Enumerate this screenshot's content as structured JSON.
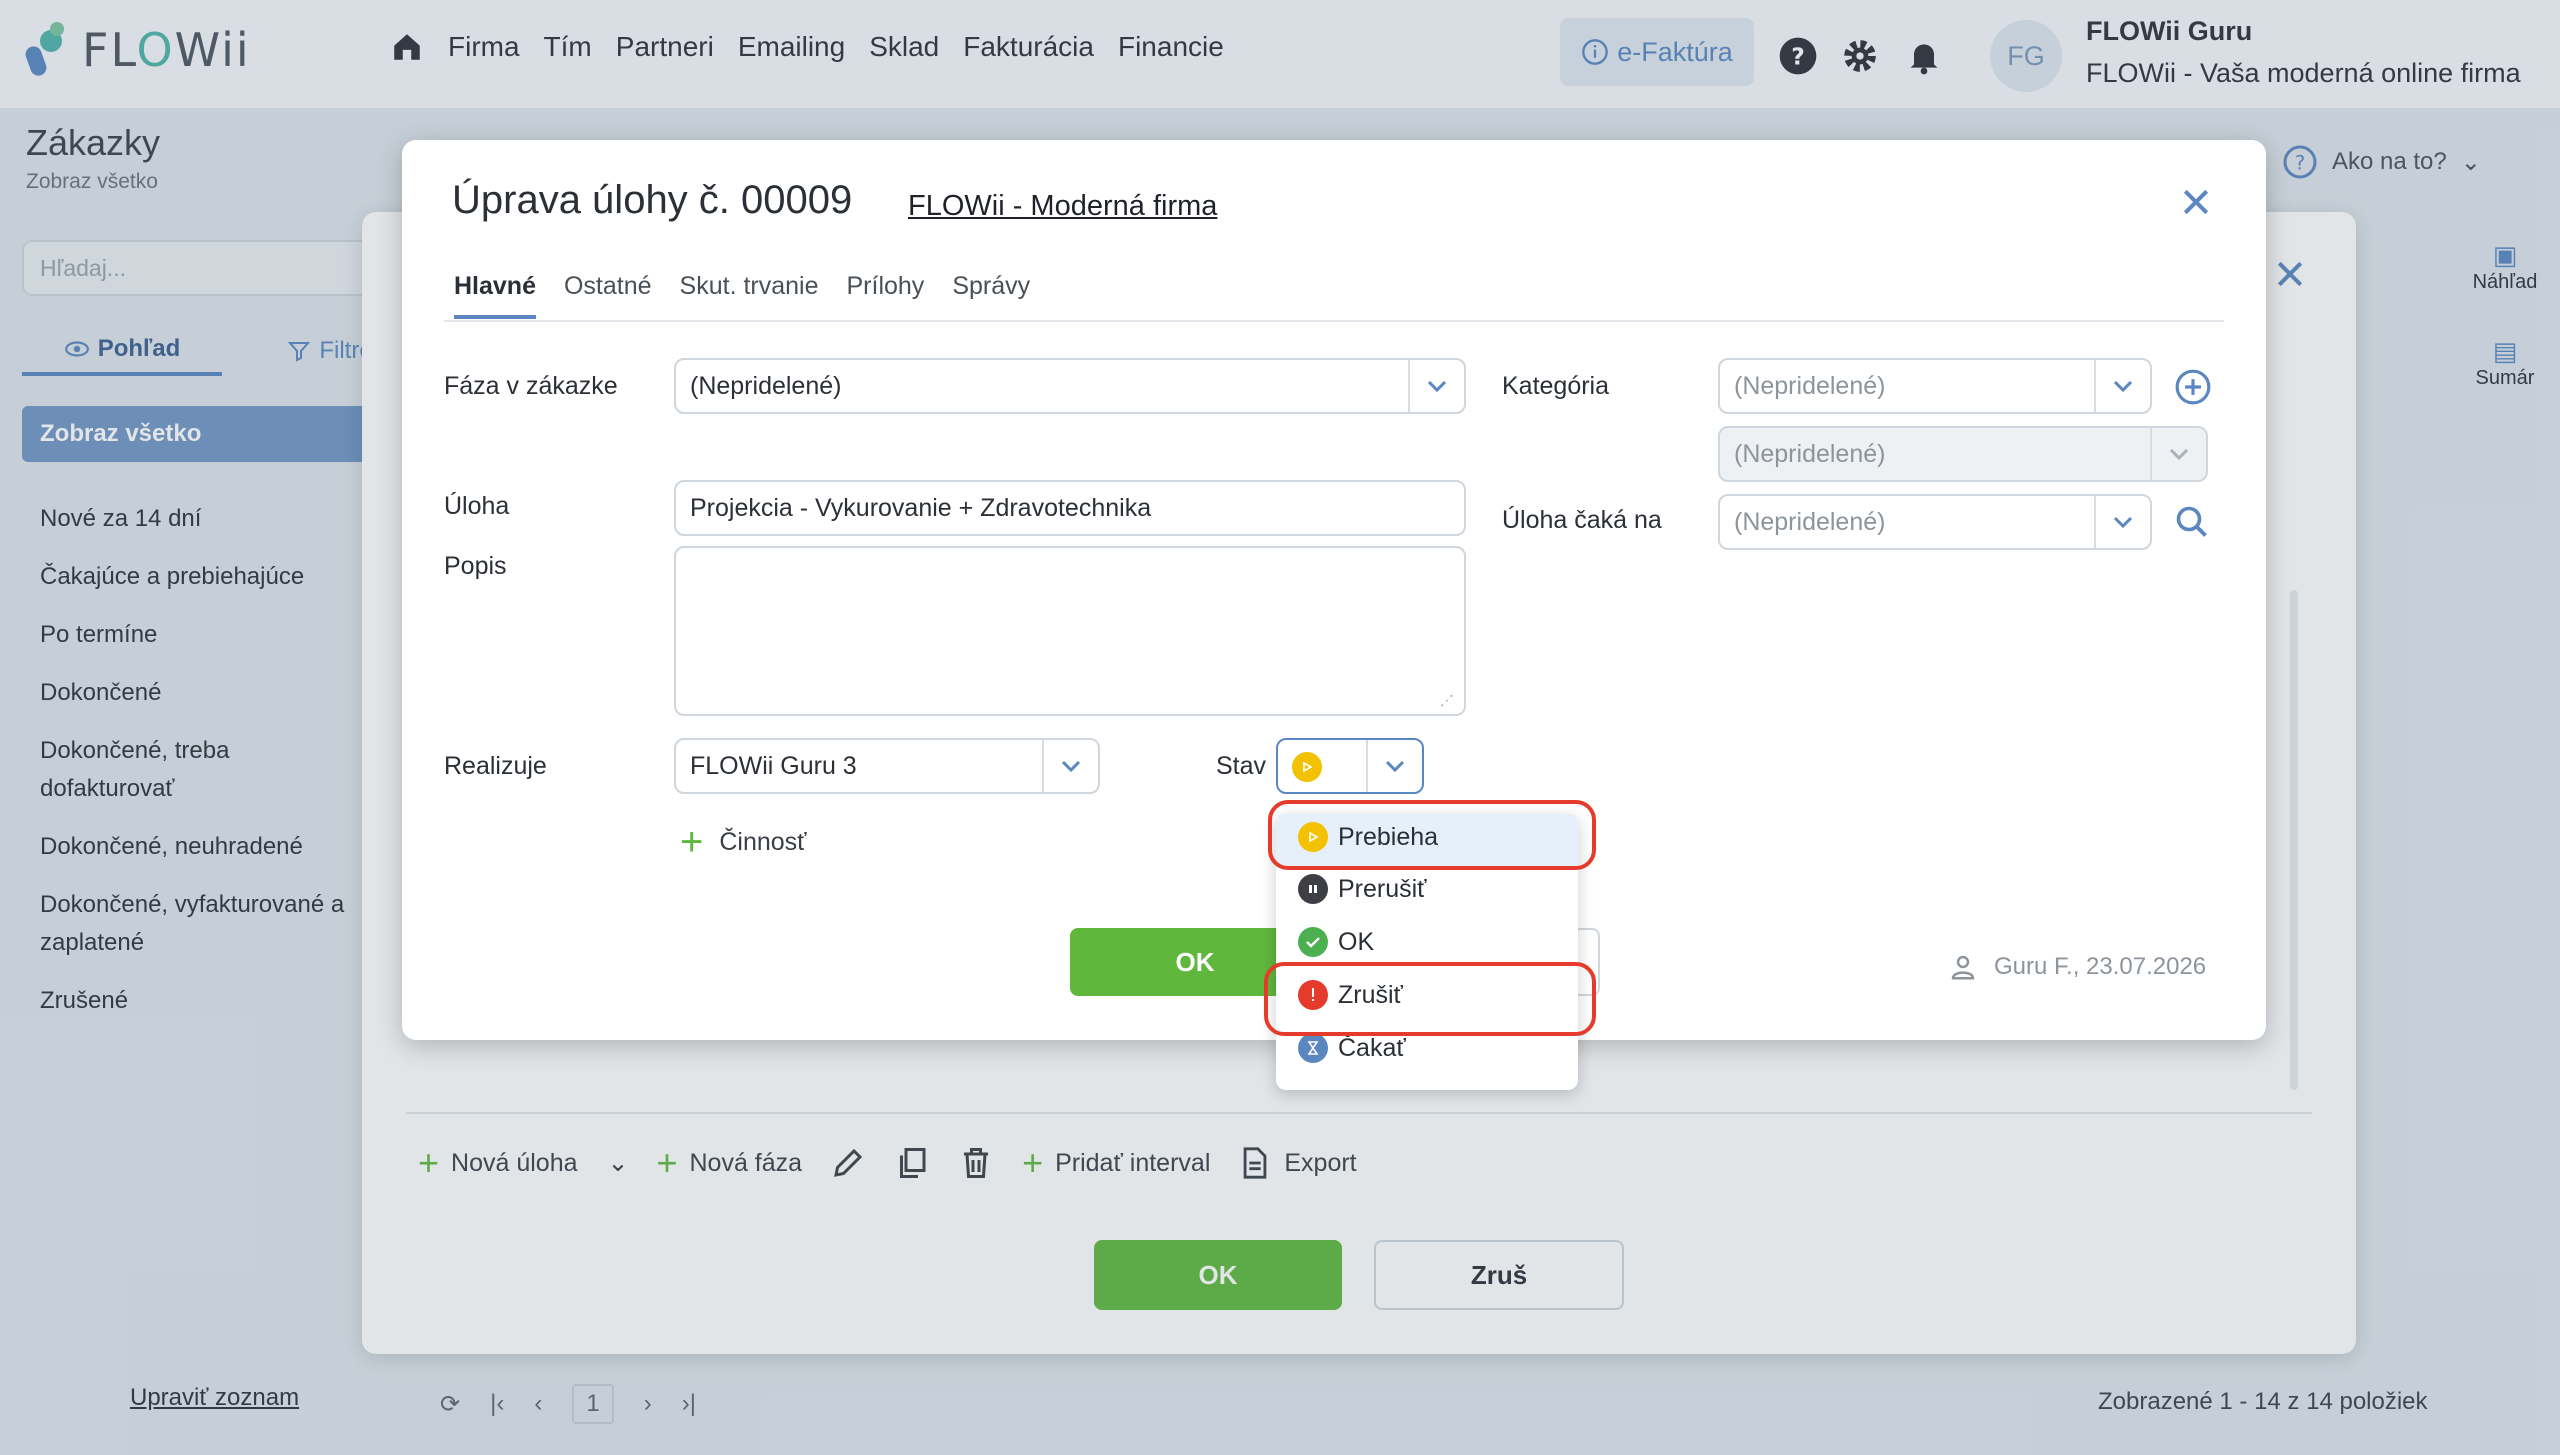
{
  "app": {
    "logo_text_a": "FL",
    "logo_text_b": "O",
    "logo_text_c": "Wii",
    "nav": [
      "Firma",
      "Tím",
      "Partneri",
      "Emailing",
      "Sklad",
      "Fakturácia",
      "Financie"
    ],
    "efaktura": "e-Faktúra",
    "user_initials": "FG",
    "user_name": "FLOWii Guru",
    "company": "FLOWii - Vaša moderná online firma"
  },
  "page": {
    "title": "Zákazky",
    "subtitle": "Zobraz všetko",
    "search_placeholder": "Hľadaj...",
    "tab_view": "Pohľad",
    "tab_filter": "Filtre",
    "active_view": "Zobraz všetko",
    "views": [
      "Nové za 14 dní",
      "Čakajúce a prebiehajúce",
      "Po termíne",
      "Dokončené",
      "Dokončené, treba dofakturovať",
      "Dokončené, neuhradené",
      "Dokončené, vyfakturované a zaplatené",
      "Zrušené"
    ],
    "edit_list": "Upraviť zoznam",
    "pager_page": "1",
    "count": "Zobrazené 1 - 14 z 14 položiek",
    "help": "Ako na to?",
    "side_preview": "Náhľad",
    "side_summary": "Sumár"
  },
  "outer_dialog": {
    "toolbar": {
      "new_task": "Nová úloha",
      "new_phase": "Nová fáza",
      "add_interval": "Pridať interval",
      "export": "Export"
    },
    "ok": "OK",
    "cancel": "Zruš"
  },
  "modal": {
    "title": "Úprava úlohy č. 00009",
    "link": "FLOWii - Moderná firma",
    "tabs": [
      "Hlavné",
      "Ostatné",
      "Skut. trvanie",
      "Prílohy",
      "Správy"
    ],
    "phase_label": "Fáza v zákazke",
    "phase_value": "(Nepridelené)",
    "task_label": "Úloha",
    "task_value": "Projekcia - Vykurovanie + Zdravotechnika",
    "desc_label": "Popis",
    "desc_value": "",
    "category_label": "Kategória",
    "category_value": "(Nepridelené)",
    "subcategory_value": "(Nepridelené)",
    "waits_label": "Úloha čaká na",
    "waits_value": "(Nepridelené)",
    "assignee_label": "Realizuje",
    "assignee_value": "FLOWii Guru 3",
    "state_label": "Stav",
    "activity": "Činnosť",
    "ok": "OK",
    "meta": "Guru F., 23.07.2026"
  },
  "status_options": [
    {
      "label": "Prebieha",
      "color": "#f2c200",
      "icon": "play-icon"
    },
    {
      "label": "Prerušiť",
      "color": "#3d3f44",
      "icon": "pause-icon"
    },
    {
      "label": "OK",
      "color": "#4caf50",
      "icon": "check-icon"
    },
    {
      "label": "Zrušiť",
      "color": "#e53b2c",
      "icon": "exclamation-icon"
    },
    {
      "label": "Čakať",
      "color": "#5a87c0",
      "icon": "hourglass-icon"
    }
  ],
  "colors": {
    "accent": "#5a87c0",
    "ok_green": "#5fb83c",
    "highlight_ring": "#e53b2c"
  }
}
